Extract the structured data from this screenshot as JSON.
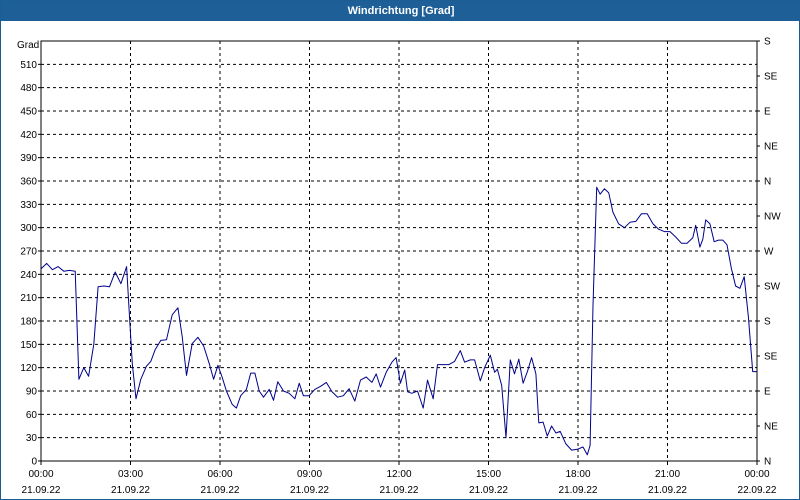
{
  "window": {
    "title": "Windrichtung [Grad]"
  },
  "colors": {
    "title_bar": "#1f5f98",
    "line": "#00008b",
    "grid": "#000000",
    "axis": "#000000"
  },
  "chart_data": {
    "type": "line",
    "title": "Windrichtung [Grad]",
    "ylabel": "Grad",
    "ylim": [
      0,
      540
    ],
    "yticks": [
      0,
      30,
      60,
      90,
      120,
      150,
      180,
      210,
      240,
      270,
      300,
      330,
      360,
      390,
      420,
      450,
      480,
      510
    ],
    "y2_ticks": [
      {
        "label": "N",
        "value": 0
      },
      {
        "label": "NE",
        "value": 45
      },
      {
        "label": "E",
        "value": 90
      },
      {
        "label": "SE",
        "value": 135
      },
      {
        "label": "S",
        "value": 180
      },
      {
        "label": "SW",
        "value": 225
      },
      {
        "label": "W",
        "value": 270
      },
      {
        "label": "NW",
        "value": 315
      },
      {
        "label": "N",
        "value": 360
      },
      {
        "label": "NE",
        "value": 405
      },
      {
        "label": "E",
        "value": 450
      },
      {
        "label": "SE",
        "value": 495
      },
      {
        "label": "S",
        "value": 540
      }
    ],
    "xlim_hours": [
      0,
      24
    ],
    "xticks": [
      {
        "time": "00:00",
        "date": "21.09.22",
        "hour": 0
      },
      {
        "time": "03:00",
        "date": "21.09.22",
        "hour": 3
      },
      {
        "time": "06:00",
        "date": "21.09.22",
        "hour": 6
      },
      {
        "time": "09:00",
        "date": "21.09.22",
        "hour": 9
      },
      {
        "time": "12:00",
        "date": "21.09.22",
        "hour": 12
      },
      {
        "time": "15:00",
        "date": "21.09.22",
        "hour": 15
      },
      {
        "time": "18:00",
        "date": "21.09.22",
        "hour": 18
      },
      {
        "time": "21:00",
        "date": "21.09.22",
        "hour": 21
      },
      {
        "time": "00:00",
        "date": "22.09.22",
        "hour": 24
      }
    ],
    "grid": true,
    "series": [
      {
        "values": [
          [
            0.0,
            247
          ],
          [
            0.2,
            254
          ],
          [
            0.4,
            246
          ],
          [
            0.6,
            250
          ],
          [
            0.8,
            244
          ],
          [
            1.0,
            245
          ],
          [
            1.2,
            244
          ],
          [
            1.33,
            105
          ],
          [
            1.5,
            120
          ],
          [
            1.67,
            109
          ],
          [
            1.85,
            150
          ],
          [
            2.0,
            224
          ],
          [
            2.2,
            225
          ],
          [
            2.4,
            224
          ],
          [
            2.6,
            243
          ],
          [
            2.8,
            228
          ],
          [
            3.0,
            250
          ],
          [
            3.1,
            188
          ],
          [
            3.2,
            125
          ],
          [
            3.33,
            80
          ],
          [
            3.5,
            105
          ],
          [
            3.7,
            122
          ],
          [
            3.85,
            128
          ],
          [
            4.0,
            143
          ],
          [
            4.2,
            155
          ],
          [
            4.4,
            156
          ],
          [
            4.6,
            188
          ],
          [
            4.8,
            197
          ],
          [
            4.95,
            160
          ],
          [
            5.1,
            110
          ],
          [
            5.3,
            151
          ],
          [
            5.5,
            159
          ],
          [
            5.7,
            148
          ],
          [
            5.9,
            125
          ],
          [
            6.05,
            105
          ],
          [
            6.2,
            123
          ],
          [
            6.35,
            108
          ],
          [
            6.5,
            90
          ],
          [
            6.7,
            73
          ],
          [
            6.85,
            68
          ],
          [
            7.0,
            84
          ],
          [
            7.2,
            92
          ],
          [
            7.35,
            113
          ],
          [
            7.5,
            113
          ],
          [
            7.65,
            90
          ],
          [
            7.8,
            82
          ],
          [
            8.0,
            92
          ],
          [
            8.15,
            78
          ],
          [
            8.3,
            102
          ],
          [
            8.5,
            90
          ],
          [
            8.7,
            87
          ],
          [
            8.9,
            80
          ],
          [
            9.05,
            100
          ],
          [
            9.2,
            84
          ],
          [
            9.4,
            84
          ],
          [
            9.6,
            92
          ],
          [
            9.8,
            96
          ],
          [
            10.0,
            101
          ],
          [
            10.2,
            89
          ],
          [
            10.4,
            82
          ],
          [
            10.6,
            84
          ],
          [
            10.8,
            93
          ],
          [
            11.0,
            77
          ],
          [
            11.2,
            104
          ],
          [
            11.4,
            108
          ],
          [
            11.6,
            101
          ],
          [
            11.75,
            112
          ],
          [
            11.9,
            95
          ],
          [
            12.1,
            114
          ],
          [
            12.3,
            127
          ],
          [
            12.45,
            133
          ],
          [
            12.6,
            100
          ],
          [
            12.75,
            117
          ],
          [
            12.85,
            89
          ],
          [
            13.0,
            87
          ],
          [
            13.2,
            90
          ],
          [
            13.4,
            68
          ],
          [
            13.55,
            104
          ],
          [
            13.75,
            80
          ],
          [
            13.9,
            124
          ],
          [
            14.1,
            124
          ],
          [
            14.3,
            124
          ],
          [
            14.5,
            128
          ],
          [
            14.7,
            142
          ],
          [
            14.85,
            127
          ],
          [
            15.05,
            130
          ],
          [
            15.2,
            130
          ],
          [
            15.4,
            103
          ],
          [
            15.55,
            120
          ],
          [
            15.75,
            136
          ],
          [
            15.9,
            114
          ],
          [
            16.0,
            118
          ],
          [
            16.15,
            97
          ],
          [
            16.3,
            30
          ],
          [
            16.45,
            130
          ],
          [
            16.6,
            112
          ],
          [
            16.75,
            131
          ],
          [
            16.9,
            100
          ],
          [
            17.05,
            115
          ],
          [
            17.2,
            133
          ],
          [
            17.35,
            112
          ],
          [
            17.45,
            49
          ],
          [
            17.6,
            50
          ],
          [
            17.75,
            32
          ],
          [
            17.9,
            45
          ],
          [
            18.05,
            36
          ],
          [
            18.2,
            38
          ],
          [
            18.4,
            22
          ],
          [
            18.6,
            14
          ],
          [
            18.8,
            15
          ],
          [
            19.0,
            18
          ],
          [
            19.15,
            8
          ],
          [
            19.25,
            20
          ],
          [
            19.35,
            200
          ],
          [
            19.48,
            352
          ],
          [
            19.6,
            343
          ],
          [
            19.75,
            350
          ],
          [
            19.9,
            345
          ],
          [
            20.05,
            320
          ],
          [
            20.25,
            305
          ],
          [
            20.45,
            300
          ],
          [
            20.65,
            307
          ],
          [
            20.85,
            308
          ],
          [
            21.05,
            318
          ],
          [
            21.25,
            318
          ],
          [
            21.45,
            305
          ],
          [
            21.65,
            298
          ],
          [
            21.85,
            295
          ],
          [
            22.05,
            295
          ],
          [
            22.25,
            288
          ],
          [
            22.45,
            280
          ],
          [
            22.65,
            280
          ],
          [
            22.85,
            287
          ],
          [
            22.95,
            303
          ],
          [
            23.1,
            275
          ],
          [
            23.2,
            285
          ],
          [
            23.3,
            310
          ],
          [
            23.45,
            305
          ],
          [
            23.6,
            282
          ],
          [
            23.75,
            284
          ],
          [
            23.9,
            284
          ],
          [
            24.05,
            278
          ],
          [
            24.2,
            248
          ],
          [
            24.35,
            225
          ],
          [
            24.5,
            222
          ],
          [
            24.65,
            237
          ],
          [
            24.8,
            185
          ],
          [
            24.95,
            115
          ],
          [
            25.1,
            115
          ]
        ]
      }
    ]
  }
}
